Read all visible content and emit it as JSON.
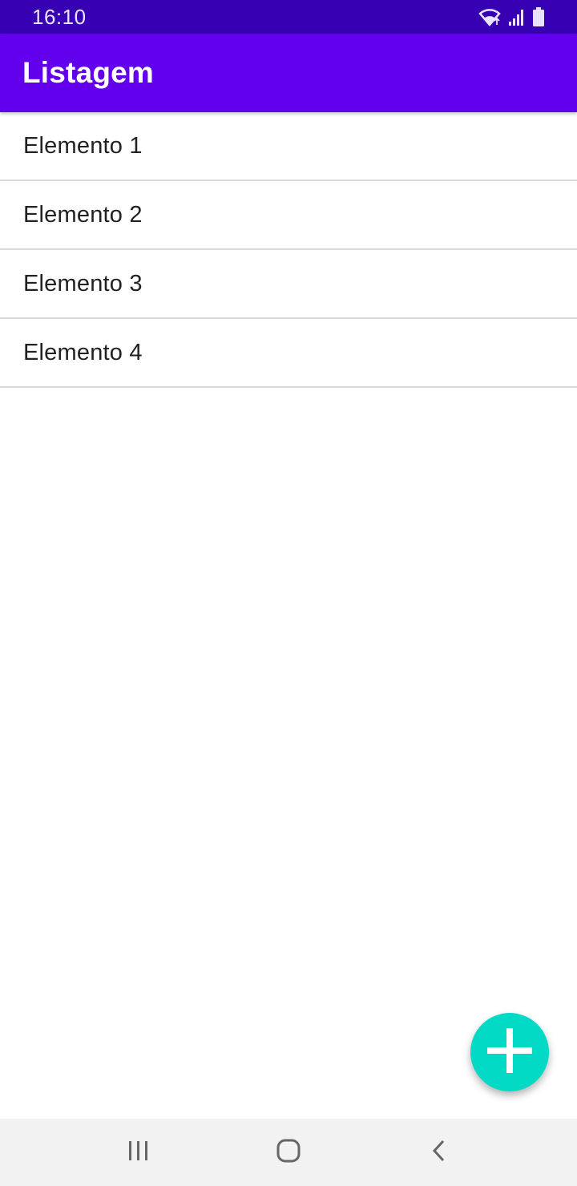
{
  "status_bar": {
    "time": "16:10",
    "icons": [
      "wifi-icon",
      "signal-icon",
      "battery-icon"
    ]
  },
  "app_bar": {
    "title": "Listagem",
    "color": "#6200ee"
  },
  "list": {
    "items": [
      {
        "label": "Elemento 1"
      },
      {
        "label": "Elemento 2"
      },
      {
        "label": "Elemento 3"
      },
      {
        "label": "Elemento 4"
      }
    ]
  },
  "fab": {
    "icon": "plus-icon",
    "color": "#03dac5"
  },
  "nav_bar": {
    "buttons": [
      "recents-icon",
      "home-icon",
      "back-icon"
    ]
  }
}
